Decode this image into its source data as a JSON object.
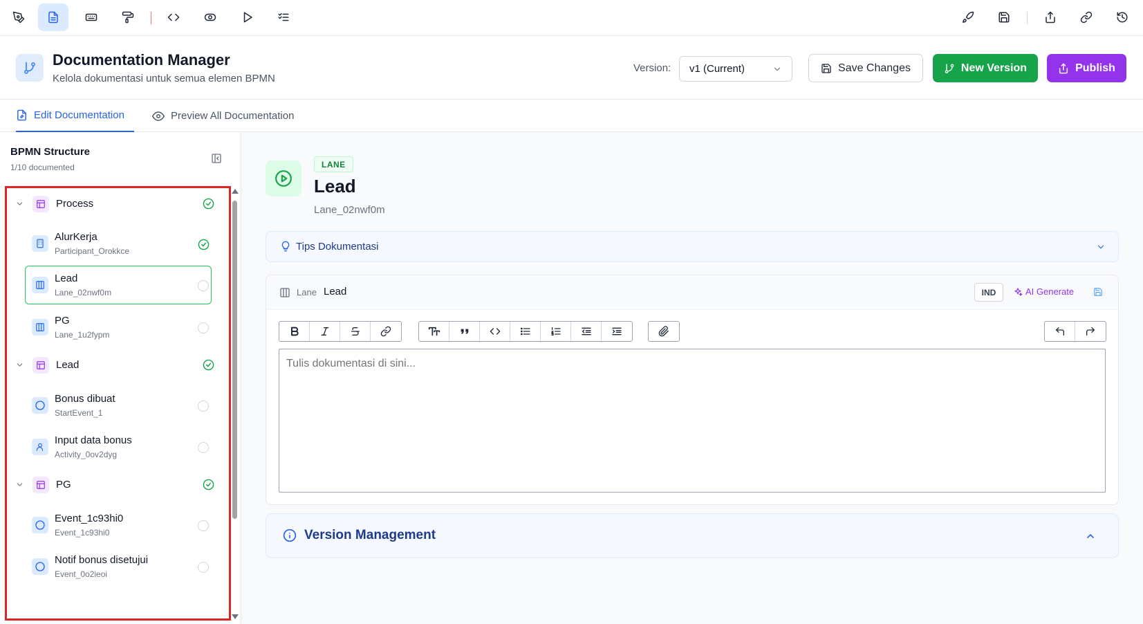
{
  "header": {
    "title": "Documentation Manager",
    "subtitle": "Kelola dokumentasi untuk semua elemen BPMN",
    "version_label": "Version:",
    "version_selected": "v1 (Current)",
    "save_label": "Save Changes",
    "new_version_label": "New Version",
    "publish_label": "Publish"
  },
  "tabs": [
    {
      "label": "Edit Documentation",
      "active": true
    },
    {
      "label": "Preview All Documentation",
      "active": false
    }
  ],
  "sidebar": {
    "title": "BPMN Structure",
    "count": "1/10 documented",
    "groups": [
      {
        "label": "Process",
        "items": [
          {
            "name": "AlurKerja",
            "id": "Participant_Orokkce",
            "documented": true
          },
          {
            "name": "Lead",
            "id": "Lane_02nwf0m",
            "documented": false
          },
          {
            "name": "PG",
            "id": "Lane_1u2fypm",
            "documented": false
          }
        ]
      },
      {
        "label": "Lead",
        "items": [
          {
            "name": "Bonus dibuat",
            "id": "StartEvent_1",
            "documented": false
          },
          {
            "name": "Input data bonus",
            "id": "Activity_0ov2dyg",
            "documented": false
          }
        ]
      },
      {
        "label": "PG",
        "items": [
          {
            "name": "Event_1c93hi0",
            "id": "Event_1c93hi0",
            "documented": false
          },
          {
            "name": "Notif bonus disetujui",
            "id": "Event_0o2ieoi",
            "documented": false
          }
        ]
      }
    ]
  },
  "element": {
    "badge": "LANE",
    "name": "Lead",
    "id": "Lane_02nwf0m"
  },
  "tips": {
    "label": "Tips Dokumentasi"
  },
  "editor": {
    "type": "Lane",
    "name": "Lead",
    "language": "IND",
    "ai_label": "AI Generate",
    "placeholder": "Tulis dokumentasi di sini..."
  },
  "version_management": {
    "title": "Version Management"
  },
  "colors": {
    "primary": "#2563eb",
    "success": "#16a34a",
    "purple": "#9333ea",
    "highlight": "#dc2626"
  }
}
